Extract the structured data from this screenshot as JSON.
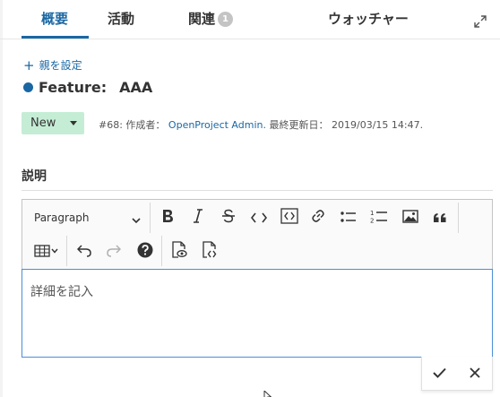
{
  "tabs": [
    {
      "label": "概要",
      "active": true
    },
    {
      "label": "活動",
      "active": false
    },
    {
      "label": "関連",
      "active": false,
      "count": "1"
    },
    {
      "label": "ウォッチャー",
      "active": false
    }
  ],
  "parent": {
    "label": "親を設定"
  },
  "work_package": {
    "type": "Feature:",
    "subject": "AAA",
    "type_color": "#1a67a3",
    "status": "New",
    "status_color": "#c5edd6",
    "meta_prefix": "#68: 作成者：",
    "author": "OpenProject Admin.",
    "meta_updated": " 最終更新日： 2019/03/15 14:47."
  },
  "description": {
    "heading": "説明",
    "placeholder": "詳細を記入"
  },
  "toolbar": {
    "paragraph": "Paragraph"
  },
  "icons": [
    "expand-icon",
    "plus-icon",
    "bold-icon",
    "italic-icon",
    "strikethrough-icon",
    "code-icon",
    "code-block-icon",
    "link-icon",
    "bulleted-list-icon",
    "numbered-list-icon",
    "image-icon",
    "quote-icon",
    "table-icon",
    "undo-icon",
    "redo-icon",
    "help-icon",
    "preview-icon",
    "source-icon",
    "check-icon",
    "close-icon"
  ],
  "colors": {
    "accent": "#1a67a3",
    "editor_border": "#4a8fd6"
  }
}
